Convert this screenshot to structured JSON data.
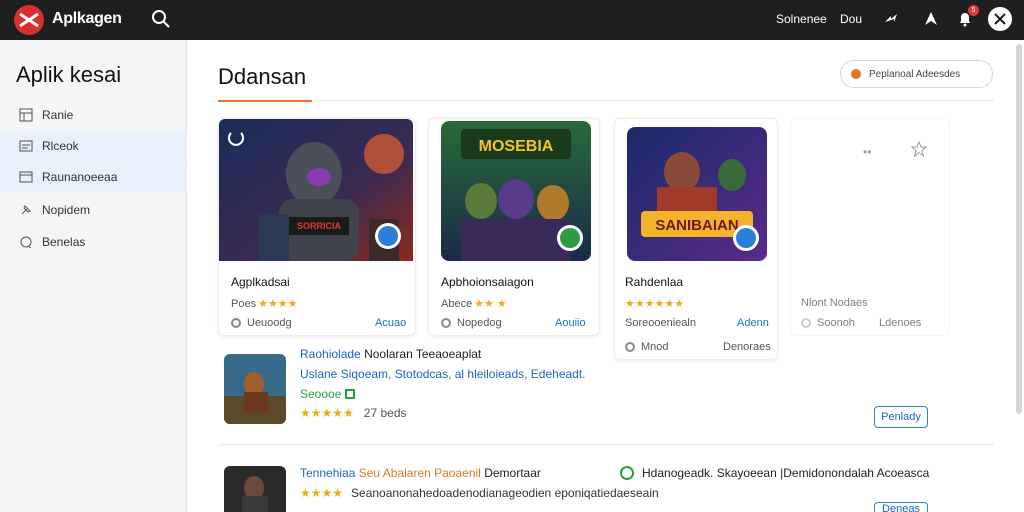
{
  "topbar": {
    "brand": "Aplkagen",
    "links": [
      "Solnenee",
      "Dou"
    ],
    "notification_count": "5",
    "bg": "#1f1f1f"
  },
  "sidebar": {
    "title": "Aplik kesai",
    "items": [
      {
        "label": "Ranie",
        "icon": "grid-icon"
      },
      {
        "label": "Rlceok",
        "icon": "list-icon"
      },
      {
        "label": "Raunanoeeaa",
        "icon": "window-icon"
      },
      {
        "label": "Nopidem",
        "icon": "pin-icon"
      },
      {
        "label": "Benelas",
        "icon": "chat-icon"
      }
    ]
  },
  "main": {
    "title": "Ddansan",
    "filter_label": "Peplanoal Adeesdes",
    "accent": "#e8742c"
  },
  "cards": [
    {
      "name": "Agplkadsai",
      "sub": "Poes",
      "stars": "★★★★",
      "meta": "Ueuoodg",
      "action": "Acuao",
      "art_text": "SORRICIA"
    },
    {
      "name": "Apbhoionsaiagon",
      "sub": "Abece",
      "stars": "★★ ★",
      "meta": "Nopedog",
      "action": "Aouiio",
      "art_text": "MOSEBIA"
    },
    {
      "name": "Rahdenlaa",
      "sub": "",
      "stars": "★★★★★★",
      "sub2": "Soreooeniealn",
      "meta": "Mnod",
      "action": "Adenn",
      "action2": "Denoraes",
      "art_text": "SANIBAIAN"
    },
    {
      "name": "",
      "sub": "Nlont Nodaes",
      "meta": "Soonoh",
      "action": "Ldenoes"
    }
  ],
  "list": [
    {
      "title_blue": "Raohiolade",
      "title_dark": "Noolaran Teeaoeaplat",
      "line2": "Uslane Siqoeam, Stotodcas, al hleiloieads, Edeheadt.",
      "line3": "Seoooe",
      "stars": "★★★★★",
      "rating": "27 beds",
      "button": "Penlady"
    },
    {
      "title_blue": "Tennehiaa",
      "title_orange": "Seu Abalaren Paoaenil",
      "title_dark": "Demortaar",
      "right_text": "Hdanogeadk. Skayoeean |Demidonondalah Acoeasca",
      "line2": "Seanoanonahedoadenodianageodien eponiqatiedaeseain",
      "stars": "★★★★",
      "button": "Deneas"
    }
  ]
}
